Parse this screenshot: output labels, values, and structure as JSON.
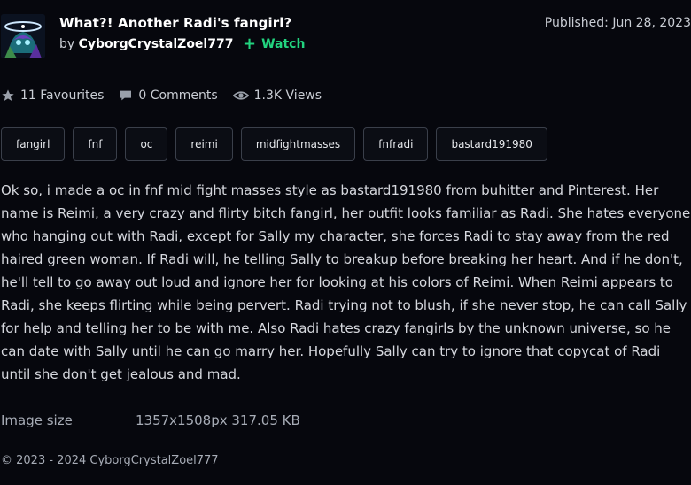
{
  "deviation": {
    "title": "What?! Another Radi's fangirl?",
    "by_label": "by",
    "author": "CyborgCrystalZoel777",
    "watch_label": "Watch",
    "published": "Published: Jun 28, 2023"
  },
  "stats": {
    "favourites": "11 Favourites",
    "comments": "0 Comments",
    "views": "1.3K Views"
  },
  "tags": [
    "fangirl",
    "fnf",
    "oc",
    "reimi",
    "midfightmasses",
    "fnfradi",
    "bastard191980"
  ],
  "description": "Ok so, i made a oc in fnf mid fight masses style as bastard191980 from buhitter and Pinterest. Her name is Reimi, a very crazy and flirty bitch fangirl, her outfit looks familiar as Radi. She hates everyone who hanging out with Radi, except for Sally my character, she forces Radi to stay away from the red haired green woman. If Radi will, he telling Sally to breakup before breaking her heart. And if he don't, he'll tell to go away out loud and ignore her for looking at his colors of Reimi. When Reimi appears to Radi, she keeps flirting while being pervert. Radi trying not to blush, if she never stop, he can call Sally for help and telling her to be with me. Also Radi hates crazy fangirls by the unknown universe, so he can date with Sally until he can go marry her. Hopefully Sally can try to ignore that copycat of Radi until she don't get jealous and mad.",
  "image_details": {
    "size_label": "Image size",
    "size_value": "1357x1508px 317.05 KB"
  },
  "footer": {
    "copyright": "© 2023 - 2024 CyborgCrystalZoel777"
  },
  "colors": {
    "background": "#06070d",
    "watch_accent": "#22d37f"
  },
  "icons": [
    "star-icon",
    "comment-icon",
    "eye-icon",
    "plus-icon"
  ]
}
